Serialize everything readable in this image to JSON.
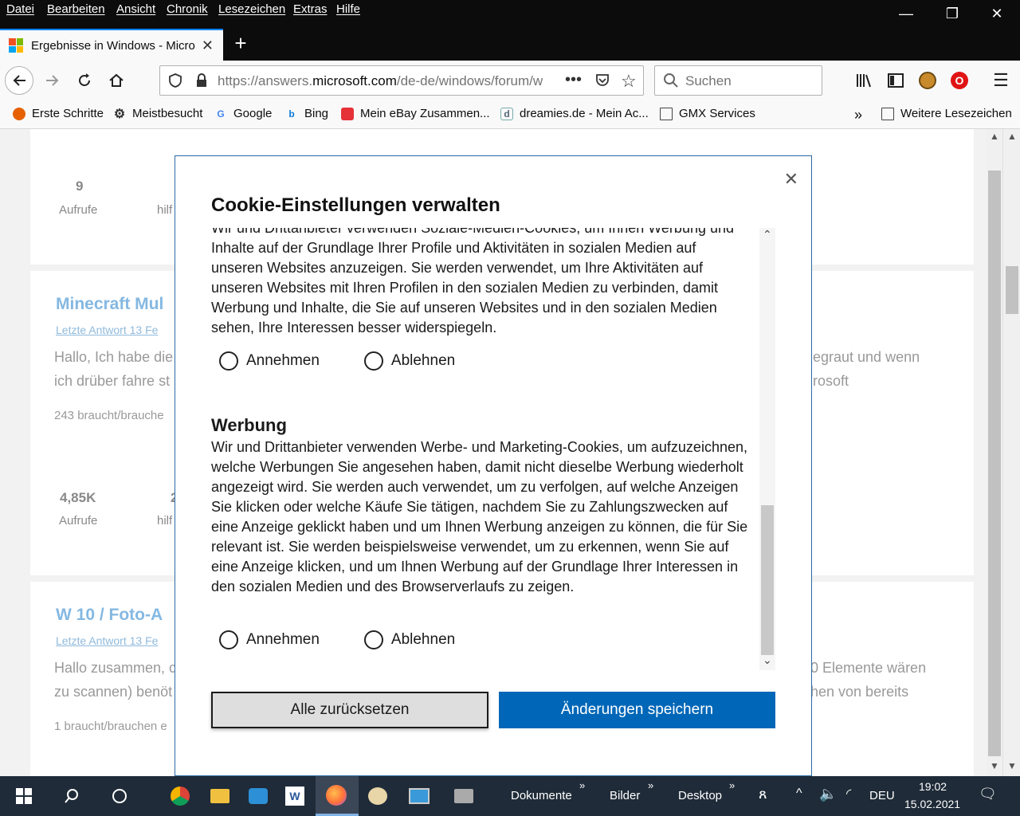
{
  "menubar": {
    "items": [
      "Datei",
      "Bearbeiten",
      "Ansicht",
      "Chronik",
      "Lesezeichen",
      "Extras",
      "Hilfe"
    ]
  },
  "tab": {
    "title": "Ergebnisse in Windows - Micro"
  },
  "navbar": {
    "url_prefix": "https://answers.",
    "url_domain": "microsoft.com",
    "url_rest": "/de-de/windows/forum/w",
    "search_placeholder": "Suchen"
  },
  "bookmarks": [
    "Erste Schritte",
    "Meistbesucht",
    "Google",
    "Bing",
    "Mein eBay Zusammen...",
    "dreamies.de - Mein Ac...",
    "GMX Services",
    "Weitere Lesezeichen"
  ],
  "page": {
    "card1": {
      "count": "9",
      "count_label": "Aufrufe",
      "helpful_label": "hilf"
    },
    "card2": {
      "title": "Minecraft Mul",
      "meta": "Letzte Antwort 13 Fe",
      "text_left_1": "Hallo, Ich habe die",
      "text_left_2": "ich drüber fahre st",
      "text_right_1": "egraut und wenn",
      "text_right_2": "rosoft",
      "small": "243 braucht/brauche",
      "count": "4,85K",
      "count_label": "Aufrufe",
      "helpful_num": "2",
      "helpful_label": "hilf"
    },
    "card3": {
      "title": "W 10 / Foto-A",
      "meta": "Letzte Antwort 13 Fe",
      "text_left_1": "Hallo zusammen, c",
      "text_left_2": "zu scannen) benöt",
      "text_right_1": "0 Elemente wären",
      "text_right_2": "hen von bereits",
      "small": "1 braucht/brauchen e"
    }
  },
  "dialog": {
    "title": "Cookie-Einstellungen verwalten",
    "social_text_partial": "Wir und Drittanbieter verwenden Soziale-Medien-Cookies, um Ihnen Werbung und",
    "social_text": "Inhalte auf der Grundlage Ihrer Profile und Aktivitäten in sozialen Medien auf unseren Websites anzuzeigen. Sie werden verwendet, um Ihre Aktivitäten auf unseren Websites mit Ihren Profilen in den sozialen Medien zu verbinden, damit Werbung und Inhalte, die Sie auf unseren Websites und in den sozialen Medien sehen, Ihre Interessen besser widerspiegeln.",
    "accept_label": "Annehmen",
    "decline_label": "Ablehnen",
    "ads_heading": "Werbung",
    "ads_text": "Wir und Drittanbieter verwenden Werbe- und Marketing-Cookies, um aufzuzeichnen, welche Werbungen Sie angesehen haben, damit nicht dieselbe Werbung wiederholt angezeigt wird. Sie werden auch verwendet, um zu verfolgen, auf welche Anzeigen Sie klicken oder welche Käufe Sie tätigen, nachdem Sie zu Zahlungszwecken auf eine Anzeige geklickt haben und um Ihnen Werbung anzeigen zu können, die für Sie relevant ist. Sie werden beispielsweise verwendet, um zu erkennen, wenn Sie auf eine Anzeige klicken, und um Ihnen Werbung auf der Grundlage Ihrer Interessen in den sozialen Medien und des Browserverlaufs zu zeigen.",
    "reset_button": "Alle zurücksetzen",
    "save_button": "Änderungen speichern"
  },
  "taskbar": {
    "folders": [
      "Dokumente",
      "Bilder",
      "Desktop"
    ],
    "language": "DEU",
    "time": "19:02",
    "date": "15.02.2021"
  },
  "colors": {
    "accent": "#0067b8",
    "link": "#84b8e2",
    "taskbar": "#1f2b38"
  }
}
